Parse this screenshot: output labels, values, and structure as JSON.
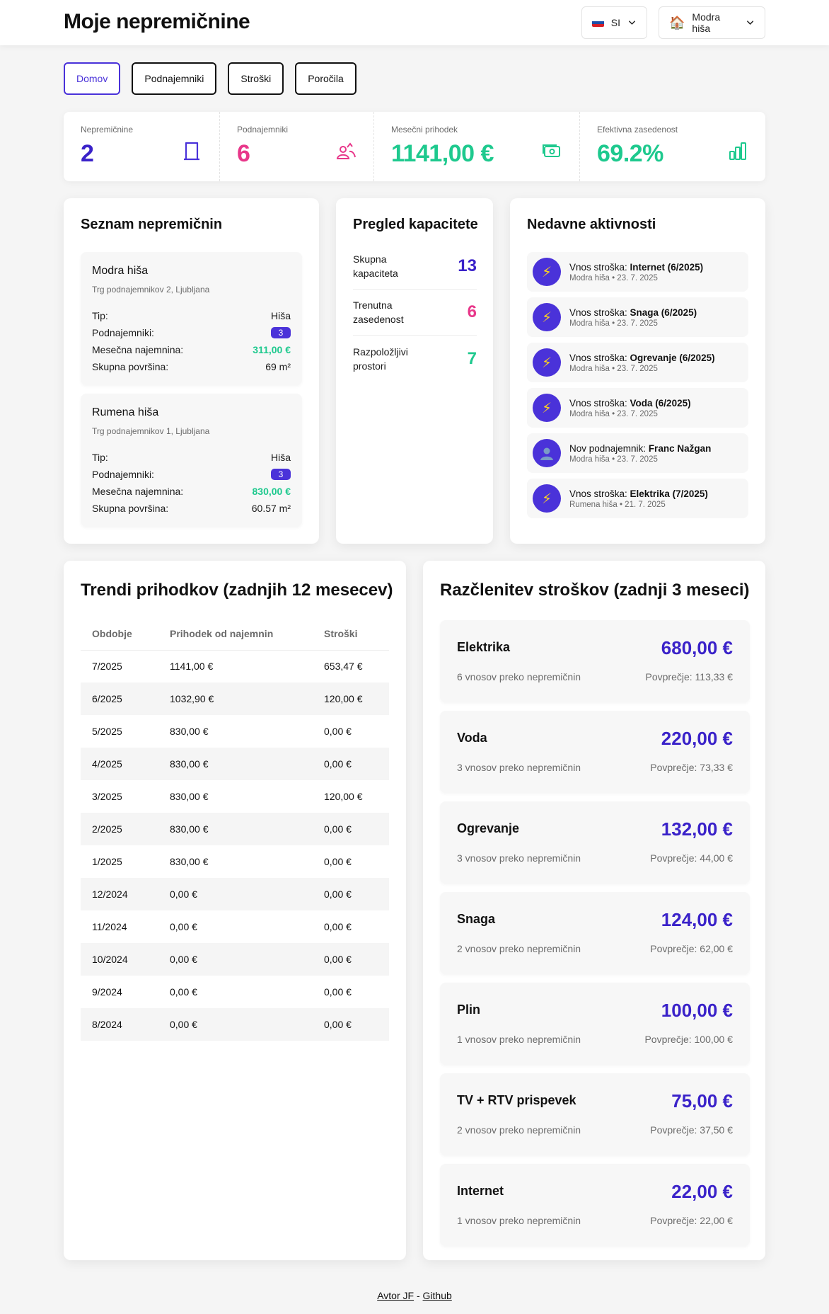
{
  "header": {
    "title": "Moje nepremičnine",
    "lang": "SI",
    "property": "Modra hiša"
  },
  "tabs": [
    "Domov",
    "Podnajemniki",
    "Stroški",
    "Poročila"
  ],
  "stats": {
    "properties": {
      "label": "Nepremičnine",
      "value": "2"
    },
    "tenants": {
      "label": "Podnajemniki",
      "value": "6"
    },
    "income": {
      "label": "Mesečni prihodek",
      "value": "1141,00 €"
    },
    "occupancy": {
      "label": "Efektivna zasedenost",
      "value": "69.2%"
    }
  },
  "property_list": {
    "title": "Seznam nepremičnin",
    "labels": {
      "type": "Tip:",
      "tenants": "Podnajemniki:",
      "rent": "Mesečna najemnina:",
      "area": "Skupna površina:"
    },
    "items": [
      {
        "name": "Modra hiša",
        "address": "Trg podnajemnikov 2, Ljubljana",
        "type": "Hiša",
        "tenants": "3",
        "rent": "311,00 €",
        "area": "69 m²"
      },
      {
        "name": "Rumena hiša",
        "address": "Trg podnajemnikov 1, Ljubljana",
        "type": "Hiša",
        "tenants": "3",
        "rent": "830,00 €",
        "area": "60.57 m²"
      }
    ]
  },
  "capacity": {
    "title": "Pregled kapacitete",
    "rows": [
      {
        "label": "Skupna kapaciteta",
        "value": "13"
      },
      {
        "label": "Trenutna zasedenost",
        "value": "6"
      },
      {
        "label": "Razpoložljivi prostori",
        "value": "7"
      }
    ]
  },
  "activities": {
    "title": "Nedavne aktivnosti",
    "items": [
      {
        "icon": "bolt-icon",
        "prefix": "Vnos stroška: ",
        "bold": "Internet (6/2025)",
        "meta": "Modra hiša • 23. 7. 2025"
      },
      {
        "icon": "bolt-icon",
        "prefix": "Vnos stroška: ",
        "bold": "Snaga (6/2025)",
        "meta": "Modra hiša • 23. 7. 2025"
      },
      {
        "icon": "bolt-icon",
        "prefix": "Vnos stroška: ",
        "bold": "Ogrevanje (6/2025)",
        "meta": "Modra hiša • 23. 7. 2025"
      },
      {
        "icon": "bolt-icon",
        "prefix": "Vnos stroška: ",
        "bold": "Voda (6/2025)",
        "meta": "Modra hiša • 23. 7. 2025"
      },
      {
        "icon": "person-icon",
        "prefix": "Nov podnajemnik: ",
        "bold": "Franc Nažgan",
        "meta": "Modra hiša • 23. 7. 2025"
      },
      {
        "icon": "bolt-icon",
        "prefix": "Vnos stroška: ",
        "bold": "Elektrika (7/2025)",
        "meta": "Rumena hiša • 21. 7. 2025"
      }
    ]
  },
  "trends": {
    "title": "Trendi prihodkov (zadnjih 12 mesecev)",
    "columns": [
      "Obdobje",
      "Prihodek od najemnin",
      "Stroški"
    ],
    "rows": [
      [
        "7/2025",
        "1141,00 €",
        "653,47 €"
      ],
      [
        "6/2025",
        "1032,90 €",
        "120,00 €"
      ],
      [
        "5/2025",
        "830,00 €",
        "0,00 €"
      ],
      [
        "4/2025",
        "830,00 €",
        "0,00 €"
      ],
      [
        "3/2025",
        "830,00 €",
        "120,00 €"
      ],
      [
        "2/2025",
        "830,00 €",
        "0,00 €"
      ],
      [
        "1/2025",
        "830,00 €",
        "0,00 €"
      ],
      [
        "12/2024",
        "0,00 €",
        "0,00 €"
      ],
      [
        "11/2024",
        "0,00 €",
        "0,00 €"
      ],
      [
        "10/2024",
        "0,00 €",
        "0,00 €"
      ],
      [
        "9/2024",
        "0,00 €",
        "0,00 €"
      ],
      [
        "8/2024",
        "0,00 €",
        "0,00 €"
      ]
    ]
  },
  "expenses": {
    "title": "Razčlenitev stroškov (zadnji 3 meseci)",
    "items": [
      {
        "name": "Elektrika",
        "amount": "680,00 €",
        "count": "6 vnosov preko nepremičnin",
        "avg": "Povprečje: 113,33 €"
      },
      {
        "name": "Voda",
        "amount": "220,00 €",
        "count": "3 vnosov preko nepremičnin",
        "avg": "Povprečje: 73,33 €"
      },
      {
        "name": "Ogrevanje",
        "amount": "132,00 €",
        "count": "3 vnosov preko nepremičnin",
        "avg": "Povprečje: 44,00 €"
      },
      {
        "name": "Snaga",
        "amount": "124,00 €",
        "count": "2 vnosov preko nepremičnin",
        "avg": "Povprečje: 62,00 €"
      },
      {
        "name": "Plin",
        "amount": "100,00 €",
        "count": "1 vnosov preko nepremičnin",
        "avg": "Povprečje: 100,00 €"
      },
      {
        "name": "TV + RTV prispevek",
        "amount": "75,00 €",
        "count": "2 vnosov preko nepremičnin",
        "avg": "Povprečje: 37,50 €"
      },
      {
        "name": "Internet",
        "amount": "22,00 €",
        "count": "1 vnosov preko nepremičnin",
        "avg": "Povprečje: 22,00 €"
      }
    ]
  },
  "footer": {
    "author": "Avtor JF",
    "separator": " - ",
    "github": "Github"
  },
  "colors": {
    "accent": "#4a32d9",
    "pink": "#e8378a",
    "green": "#1ec98e"
  }
}
